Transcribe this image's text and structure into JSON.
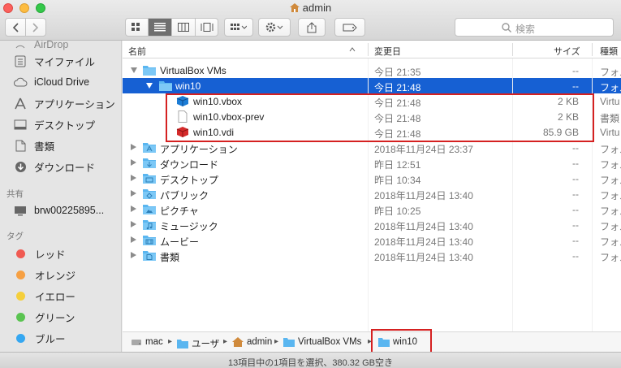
{
  "window": {
    "title": "admin"
  },
  "toolbar": {
    "search_placeholder": "検索"
  },
  "sidebar": {
    "items": [
      {
        "label": "AirDrop"
      },
      {
        "label": "マイファイル"
      },
      {
        "label": "iCloud Drive"
      },
      {
        "label": "アプリケーション"
      },
      {
        "label": "デスクトップ"
      },
      {
        "label": "書類"
      },
      {
        "label": "ダウンロード"
      }
    ],
    "shared_heading": "共有",
    "shared_items": [
      {
        "label": "brw00225895..."
      }
    ],
    "tags_heading": "タグ",
    "tags": [
      {
        "label": "レッド",
        "color": "#f05a52"
      },
      {
        "label": "オレンジ",
        "color": "#f6a043"
      },
      {
        "label": "イエロー",
        "color": "#f5cf3b"
      },
      {
        "label": "グリーン",
        "color": "#5ac451"
      },
      {
        "label": "ブルー",
        "color": "#35a7f1"
      }
    ]
  },
  "columns": {
    "name": "名前",
    "modified": "変更日",
    "size": "サイズ",
    "kind": "種類"
  },
  "rows": [
    {
      "name": "VirtualBox VMs",
      "modified": "今日 21:35",
      "size": "--",
      "kind": "フォル"
    },
    {
      "name": "win10",
      "modified": "今日 21:48",
      "size": "--",
      "kind": "フォル"
    },
    {
      "name": "win10.vbox",
      "modified": "今日 21:48",
      "size": "2 KB",
      "kind": "Virtu"
    },
    {
      "name": "win10.vbox-prev",
      "modified": "今日 21:48",
      "size": "2 KB",
      "kind": "書類"
    },
    {
      "name": "win10.vdi",
      "modified": "今日 21:48",
      "size": "85.9 GB",
      "kind": "Virtu"
    },
    {
      "name": "アプリケーション",
      "modified": "2018年11月24日 23:37",
      "size": "--",
      "kind": "フォル"
    },
    {
      "name": "ダウンロード",
      "modified": "昨日 12:51",
      "size": "--",
      "kind": "フォル"
    },
    {
      "name": "デスクトップ",
      "modified": "昨日 10:34",
      "size": "--",
      "kind": "フォル"
    },
    {
      "name": "パブリック",
      "modified": "2018年11月24日 13:40",
      "size": "--",
      "kind": "フォル"
    },
    {
      "name": "ピクチャ",
      "modified": "昨日 10:25",
      "size": "--",
      "kind": "フォル"
    },
    {
      "name": "ミュージック",
      "modified": "2018年11月24日 13:40",
      "size": "--",
      "kind": "フォル"
    },
    {
      "name": "ムービー",
      "modified": "2018年11月24日 13:40",
      "size": "--",
      "kind": "フォル"
    },
    {
      "name": "書類",
      "modified": "2018年11月24日 13:40",
      "size": "--",
      "kind": "フォル"
    }
  ],
  "path": [
    "mac",
    "ユーザ",
    "admin",
    "VirtualBox VMs",
    "win10"
  ],
  "status": "13項目中の1項目を選択、380.32 GB空き",
  "colors": {
    "selection": "#1660d3",
    "folder": "#5ab6f0",
    "annotation": "#d52121"
  }
}
